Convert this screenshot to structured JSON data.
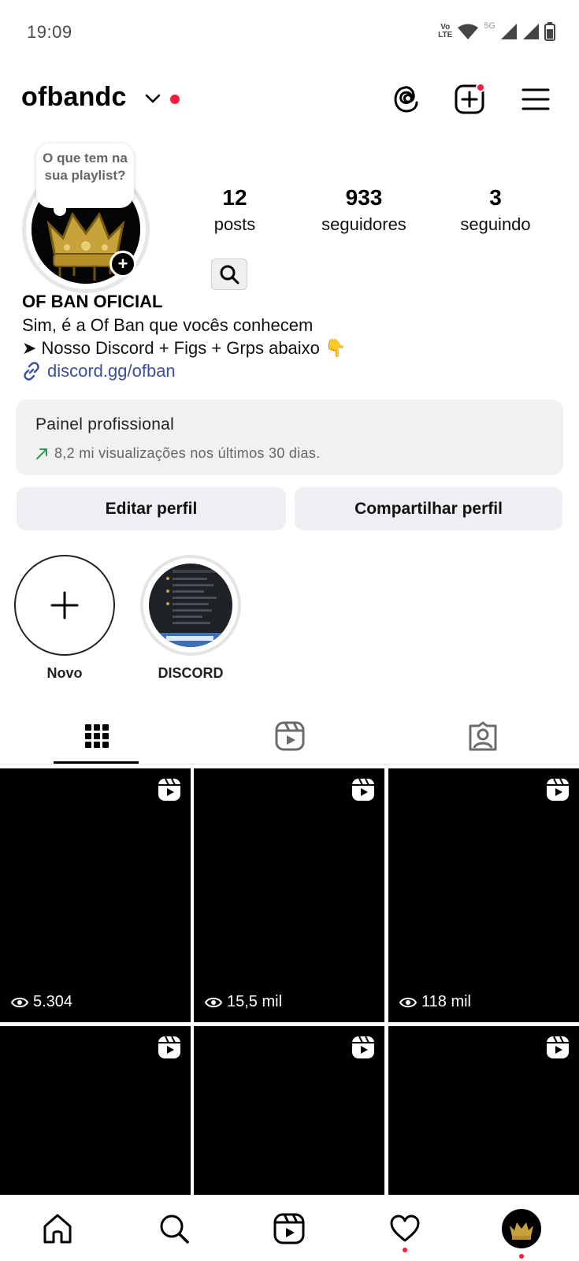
{
  "status_bar": {
    "time": "19:09",
    "network_label_top": "Vo",
    "network_label_bottom": "LTE",
    "fiveg": "5G"
  },
  "header": {
    "username": "ofbandc"
  },
  "profile": {
    "note": "O que tem na sua playlist?",
    "stats": [
      {
        "value": "12",
        "label": "posts"
      },
      {
        "value": "933",
        "label": "seguidores"
      },
      {
        "value": "3",
        "label": "seguindo"
      }
    ],
    "display_name": "OF BAN OFICIAL",
    "bio_line1": "Sim, é a Of Ban que vocês conhecem",
    "bio_line2": "   ➤ Nosso Discord  + Figs + Grps abaixo 👇",
    "link": "discord.gg/ofban"
  },
  "pro_panel": {
    "title": "Painel profissional",
    "subtitle": "8,2 mi visualizações nos últimos 30 dias."
  },
  "buttons": {
    "edit": "Editar perfil",
    "share": "Compartilhar perfil"
  },
  "highlights": [
    {
      "label": "Novo"
    },
    {
      "label": "DISCORD"
    }
  ],
  "grid": [
    {
      "views": "5.304"
    },
    {
      "views": "15,5 mil"
    },
    {
      "views": "118 mil"
    },
    {
      "views": ""
    },
    {
      "views": ""
    },
    {
      "views": ""
    }
  ],
  "colors": {
    "accent_red": "#ff1a3d",
    "link_blue": "#3a4fa3",
    "panel_bg": "#f1f1f3",
    "trend_green": "#2e9a4f"
  },
  "icons": {
    "header": [
      "threads-icon",
      "create-icon",
      "menu-icon"
    ],
    "tabs": [
      "grid-icon",
      "reels-icon",
      "tagged-icon"
    ],
    "nav": [
      "home-icon",
      "search-icon",
      "reels-icon",
      "heart-icon",
      "profile-avatar"
    ]
  }
}
